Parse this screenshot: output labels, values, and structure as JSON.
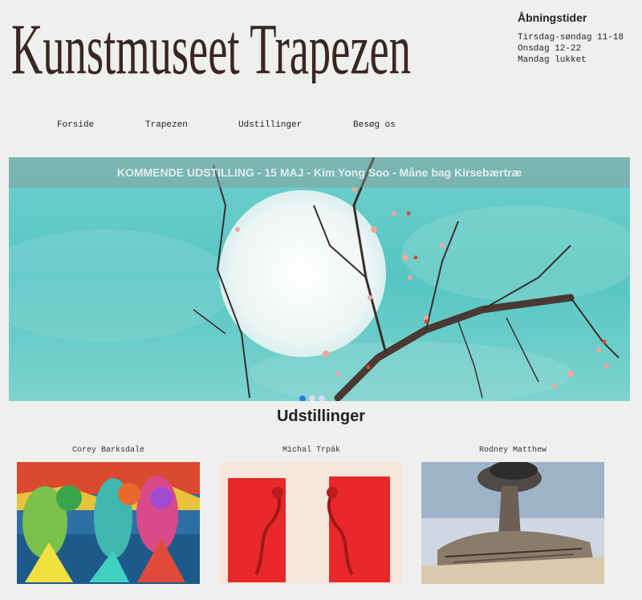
{
  "site": {
    "title": "Kunstmuseet Trapezen"
  },
  "hours": {
    "title": "Åbningstider",
    "lines": [
      "Tirsdag-søndag 11-18",
      "Onsdag 12-22",
      "Mandag lukket"
    ]
  },
  "nav": {
    "items": [
      "Forside",
      "Trapezen",
      "Udstillinger",
      "Besøg os"
    ]
  },
  "hero": {
    "banner": "KOMMENDE UDSTILLING - 15 MAJ - Kim Yong Soo - Måne bag Kirsebærtræ",
    "slides": 3,
    "active_slide": 1
  },
  "exhibitions": {
    "title": "Udstillinger",
    "artists": [
      "Corey Barksdale",
      "Michal Trpák",
      "Rodney Matthew"
    ]
  },
  "colors": {
    "background": "#eef0ee",
    "sky": "#5cc7c4",
    "red_panel": "#e8282a",
    "banner_text": "#dfeeed"
  }
}
